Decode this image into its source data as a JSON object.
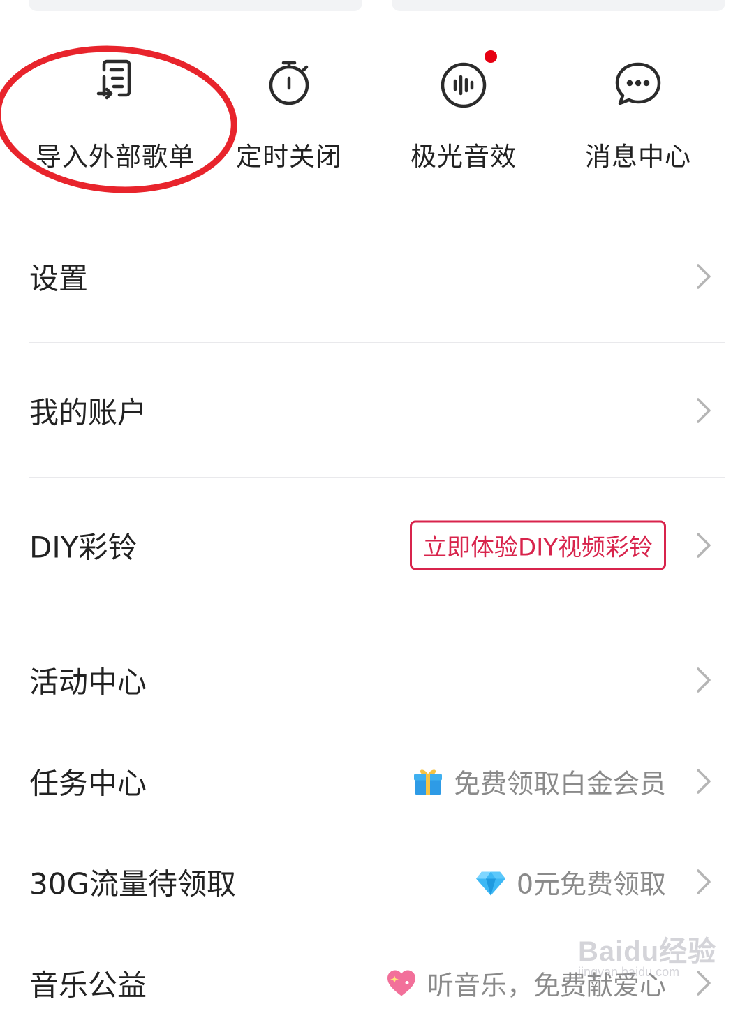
{
  "quick_actions": [
    {
      "label": "导入外部歌单",
      "icon": "import-list-icon"
    },
    {
      "label": "定时关闭",
      "icon": "timer-icon"
    },
    {
      "label": "极光音效",
      "icon": "sound-effect-icon",
      "has_badge": true
    },
    {
      "label": "消息中心",
      "icon": "message-icon"
    }
  ],
  "menu": {
    "settings": "设置",
    "account": "我的账户",
    "diy": {
      "label": "DIY彩铃",
      "badge": "立即体验DIY视频彩铃"
    },
    "activity": "活动中心",
    "tasks": {
      "label": "任务中心",
      "hint": "免费领取白金会员",
      "hint_icon": "gift-icon"
    },
    "data": {
      "label": "30G流量待领取",
      "hint": "0元免费领取",
      "hint_icon": "diamond-icon"
    },
    "charity": {
      "label": "音乐公益",
      "hint": "听音乐，免费献爱心",
      "hint_icon": "heart-icon"
    }
  },
  "watermark": {
    "brand": "Baidu经验",
    "url": "jingyan.baidu.com"
  },
  "colors": {
    "accent_red": "#d8244c",
    "annotation_red": "#e8242c",
    "badge_dot": "#e60012"
  }
}
